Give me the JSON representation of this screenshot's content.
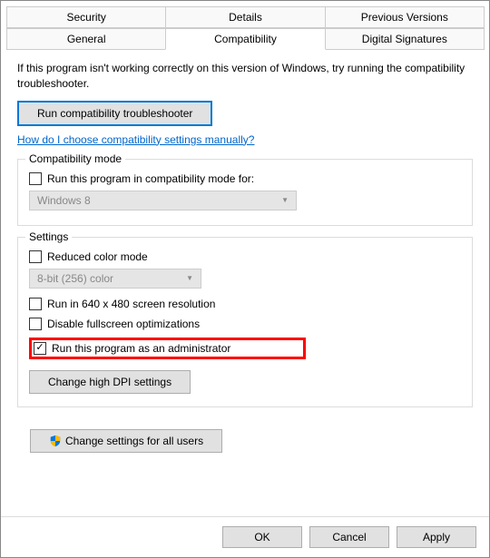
{
  "tabs": {
    "row1": [
      "Security",
      "Details",
      "Previous Versions"
    ],
    "row2": [
      "General",
      "Compatibility",
      "Digital Signatures"
    ],
    "active": "Compatibility"
  },
  "intro": "If this program isn't working correctly on this version of Windows, try running the compatibility troubleshooter.",
  "troubleshooter": "Run compatibility troubleshooter",
  "help_link": "How do I choose compatibility settings manually?",
  "compat_mode": {
    "title": "Compatibility mode",
    "checkbox": "Run this program in compatibility mode for:",
    "dropdown": "Windows 8"
  },
  "settings": {
    "title": "Settings",
    "reduced_color": "Reduced color mode",
    "color_dropdown": "8-bit (256) color",
    "run_640": "Run in 640 x 480 screen resolution",
    "disable_fullscreen": "Disable fullscreen optimizations",
    "run_admin": "Run this program as an administrator",
    "dpi_btn": "Change high DPI settings"
  },
  "all_users_btn": "Change settings for all users",
  "footer": {
    "ok": "OK",
    "cancel": "Cancel",
    "apply": "Apply"
  }
}
